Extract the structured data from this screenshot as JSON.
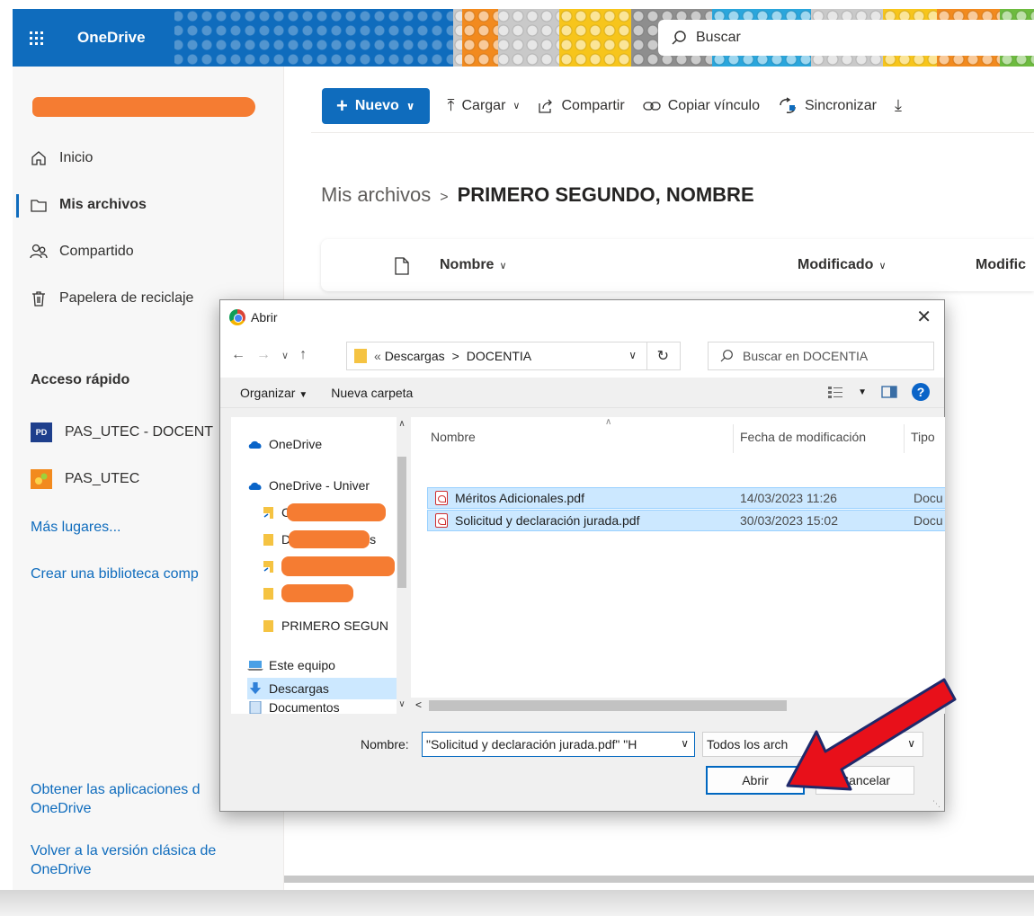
{
  "app": {
    "name": "OneDrive"
  },
  "search": {
    "placeholder": "Buscar"
  },
  "nav": {
    "items": [
      {
        "label": "Inicio",
        "icon": "home-icon"
      },
      {
        "label": "Mis archivos",
        "icon": "folder-icon"
      },
      {
        "label": "Compartido",
        "icon": "people-icon"
      },
      {
        "label": "Papelera de reciclaje",
        "icon": "trash-icon"
      }
    ],
    "quick_access_title": "Acceso rápido",
    "quick_access": [
      {
        "label": "PAS_UTEC - DOCENT",
        "badge": "PD"
      },
      {
        "label": "PAS_UTEC"
      }
    ],
    "more_places": "Más lugares...",
    "create_library": "Crear una biblioteca comp",
    "get_apps": "Obtener las aplicaciones d OneDrive",
    "classic": "Volver a la versión clásica de OneDrive"
  },
  "commands": {
    "new": "Nuevo",
    "upload": "Cargar",
    "share": "Compartir",
    "copy_link": "Copiar vínculo",
    "sync": "Sincronizar"
  },
  "breadcrumb": {
    "root": "Mis archivos",
    "current": "PRIMERO SEGUNDO, NOMBRE"
  },
  "list_header": {
    "name": "Nombre",
    "modified": "Modificado",
    "modified_by": "Modific"
  },
  "dialog": {
    "title": "Abrir",
    "path_prefix": "«",
    "path": [
      "Descargas",
      "DOCENTIA"
    ],
    "search_placeholder": "Buscar en DOCENTIA",
    "organize": "Organizar",
    "new_folder": "Nueva carpeta",
    "tree": [
      {
        "label": "OneDrive"
      },
      {
        "label": "OneDrive - Univer"
      },
      {
        "label": "C"
      },
      {
        "label": "D",
        "suffix": "s"
      },
      {
        "label": ""
      },
      {
        "label": ""
      },
      {
        "label": "PRIMERO SEGUN"
      },
      {
        "label": "Este equipo"
      },
      {
        "label": "Descargas"
      },
      {
        "label": "Documentos"
      }
    ],
    "columns": {
      "name": "Nombre",
      "date": "Fecha de modificación",
      "type": "Tipo"
    },
    "files": [
      {
        "name": "Méritos Adicionales.pdf",
        "date": "14/03/2023 11:26",
        "type": "Docu"
      },
      {
        "name": "Solicitud y declaración jurada.pdf",
        "date": "30/03/2023 15:02",
        "type": "Docu"
      }
    ],
    "filename_label": "Nombre:",
    "filename_value": "\"Solicitud y declaración jurada.pdf\" \"H",
    "filetype_value": "Todos los arch",
    "open_button": "Abrir",
    "cancel_button": "Cancelar"
  },
  "colors": {
    "accent": "#0f6cbd",
    "redaction": "#f57c32",
    "arrow": "#e8101a"
  }
}
